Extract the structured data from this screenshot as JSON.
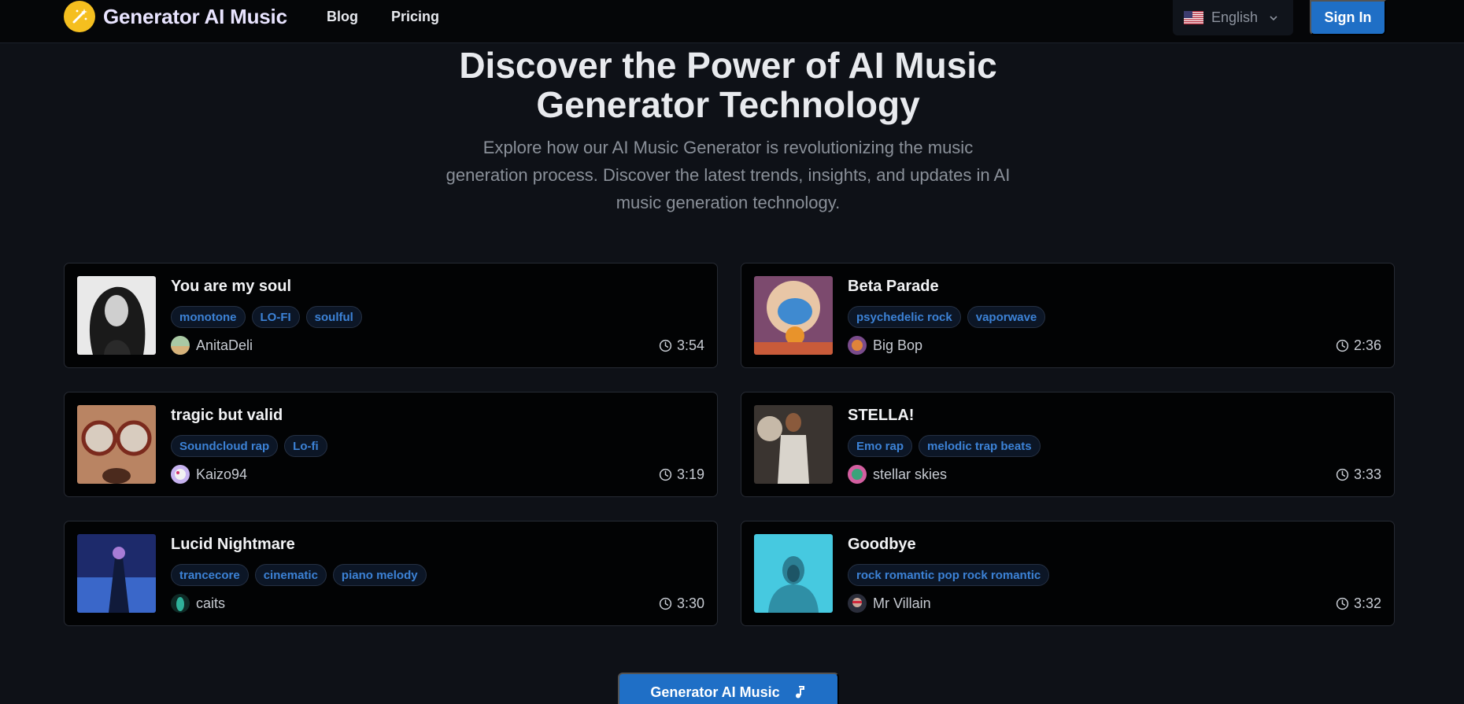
{
  "header": {
    "brand": "Generator AI Music",
    "nav": [
      {
        "label": "Blog"
      },
      {
        "label": "Pricing"
      }
    ],
    "language": "English",
    "sign_in": "Sign In"
  },
  "hero": {
    "title": "Discover the Power of AI Music Generator Technology",
    "subtitle": "Explore how our AI Music Generator is revolutionizing the music generation process. Discover the latest trends, insights, and updates in AI music generation technology."
  },
  "songs": [
    {
      "title": "You are my soul",
      "tags": [
        "monotone",
        "LO-FI",
        "soulful"
      ],
      "author": "AnitaDeli",
      "duration": "3:54"
    },
    {
      "title": "Beta Parade",
      "tags": [
        "psychedelic rock",
        "vaporwave"
      ],
      "author": "Big Bop",
      "duration": "2:36"
    },
    {
      "title": "tragic but valid",
      "tags": [
        "Soundcloud rap",
        "Lo-fi"
      ],
      "author": "Kaizo94",
      "duration": "3:19"
    },
    {
      "title": "STELLA!",
      "tags": [
        "Emo rap",
        "melodic trap beats"
      ],
      "author": "stellar skies",
      "duration": "3:33"
    },
    {
      "title": "Lucid Nightmare",
      "tags": [
        "trancecore",
        "cinematic",
        "piano melody"
      ],
      "author": "caits",
      "duration": "3:30"
    },
    {
      "title": "Goodbye",
      "tags": [
        "rock romantic pop rock romantic"
      ],
      "author": "Mr Villain",
      "duration": "3:32"
    }
  ],
  "cta": {
    "label": "Generator AI Music"
  },
  "icons": {
    "logo": "magic-wand-icon",
    "flag": "us-flag-icon",
    "chevron": "chevron-down-icon",
    "clock": "clock-icon",
    "note": "music-note-icon"
  },
  "colors": {
    "accent": "#1f6fc6",
    "tag_text": "#3c82d6",
    "logo_yellow": "#f5bf1f"
  }
}
